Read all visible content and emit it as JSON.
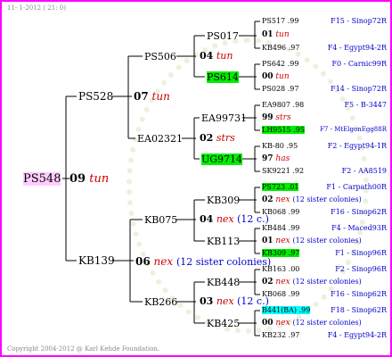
{
  "header": "11-  1-2012 ( 21:  0)",
  "footer": "Copyright 2004-2012 @ Karl Kehde Foundation.",
  "root": {
    "id": "PS548",
    "year": "09",
    "name": "tun"
  },
  "gen1": [
    {
      "id": "PS528",
      "year": "07",
      "name": "tun"
    },
    {
      "id": "KB139",
      "year": "06",
      "name": "nex",
      "sis": "(12 sister colonies)"
    }
  ],
  "gen2": [
    {
      "id": "PS506",
      "year": "04",
      "name": "tun"
    },
    {
      "id": "EA02321",
      "year": "02",
      "name": "strs"
    },
    {
      "id": "KB075",
      "year": "04",
      "name": "nex",
      "sis": "(12 c.)"
    },
    {
      "id": "KB266",
      "year": "03",
      "name": "nex",
      "sis": "(12 c.)"
    }
  ],
  "gen3": [
    {
      "id": "PS017"
    },
    {
      "id": "PS614"
    },
    {
      "id": "EA99731"
    },
    {
      "id": "UG9714"
    },
    {
      "id": "KB309"
    },
    {
      "id": "KB113"
    },
    {
      "id": "KB448"
    },
    {
      "id": "KB425"
    }
  ],
  "gen4": [
    {
      "top": {
        "id": "PS517",
        "yr": ".99",
        "note": "F15 - Sinop72R"
      },
      "mid": {
        "year": "01",
        "name": "tun"
      },
      "bot": {
        "id": "KB496",
        "yr": ".97",
        "note": "F4 - Egypt94-2R"
      }
    },
    {
      "top": {
        "id": "PS642",
        "yr": ".99",
        "note": "F0 - Carnic99R"
      },
      "mid": {
        "year": "00",
        "name": "tun"
      },
      "bot": {
        "id": "PS028",
        "yr": ".97",
        "note": "F14 - Sinop72R"
      }
    },
    {
      "top": {
        "id": "EA9807",
        "yr": ".98",
        "note": "F5 - B-3447"
      },
      "mid": {
        "year": "99",
        "name": "strs"
      },
      "bot": {
        "id": "LH9515",
        "yr": ".95",
        "note": "F7 - MtElgonEgg88R"
      }
    },
    {
      "top": {
        "id": "KB-80",
        "yr": ".95",
        "note": "F2 - Egypt94-1R"
      },
      "mid": {
        "year": "97",
        "name": "has"
      },
      "bot": {
        "id": "SK9221",
        "yr": ".92",
        "note": "F2 - AA8519"
      }
    },
    {
      "top": {
        "id": "PS723",
        "yr": ".01",
        "note": "F1 - Carpath00R"
      },
      "mid": {
        "year": "02",
        "name": "nex",
        "sis": "(12 sister colonies)"
      },
      "bot": {
        "id": "KB068",
        "yr": ".99",
        "note": "F16 - Sinop62R"
      }
    },
    {
      "top": {
        "id": "KB484",
        "yr": ".99",
        "note": "F4 - Maced93R"
      },
      "mid": {
        "year": "01",
        "name": "nex",
        "sis": "(12 sister colonies)"
      },
      "bot": {
        "id": "KB309",
        "yr": ".97",
        "note": "F1 - Sinop96R"
      }
    },
    {
      "top": {
        "id": "KB163",
        "yr": ".00",
        "note": "F2 - Sinop96R"
      },
      "mid": {
        "year": "02",
        "name": "nex",
        "sis": "(12 sister colonies)"
      },
      "bot": {
        "id": "KB068",
        "yr": ".99",
        "note": "F16 - Sinop62R"
      }
    },
    {
      "top": {
        "id": "B441(BA)",
        "yr": ".99",
        "note": "F18 - Sinop62R"
      },
      "mid": {
        "year": "00",
        "name": "nex",
        "sis": "(12 sister colonies)"
      },
      "bot": {
        "id": "KB232",
        "yr": ".97",
        "note": "F4 - Egypt94-2R"
      }
    }
  ]
}
